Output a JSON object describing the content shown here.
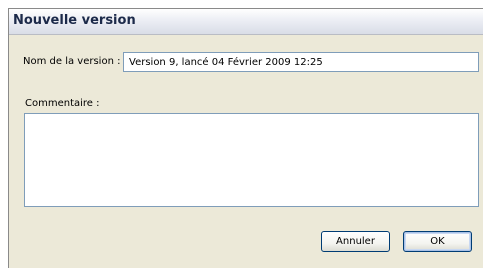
{
  "dialog": {
    "title": "Nouvelle version",
    "name_label": "Nom de la version :",
    "name_value": "Version 9, lancé 04 Février 2009 12:25",
    "comment_label": "Commentaire :",
    "comment_value": "",
    "cancel_label": "Annuler",
    "ok_label": "OK"
  }
}
